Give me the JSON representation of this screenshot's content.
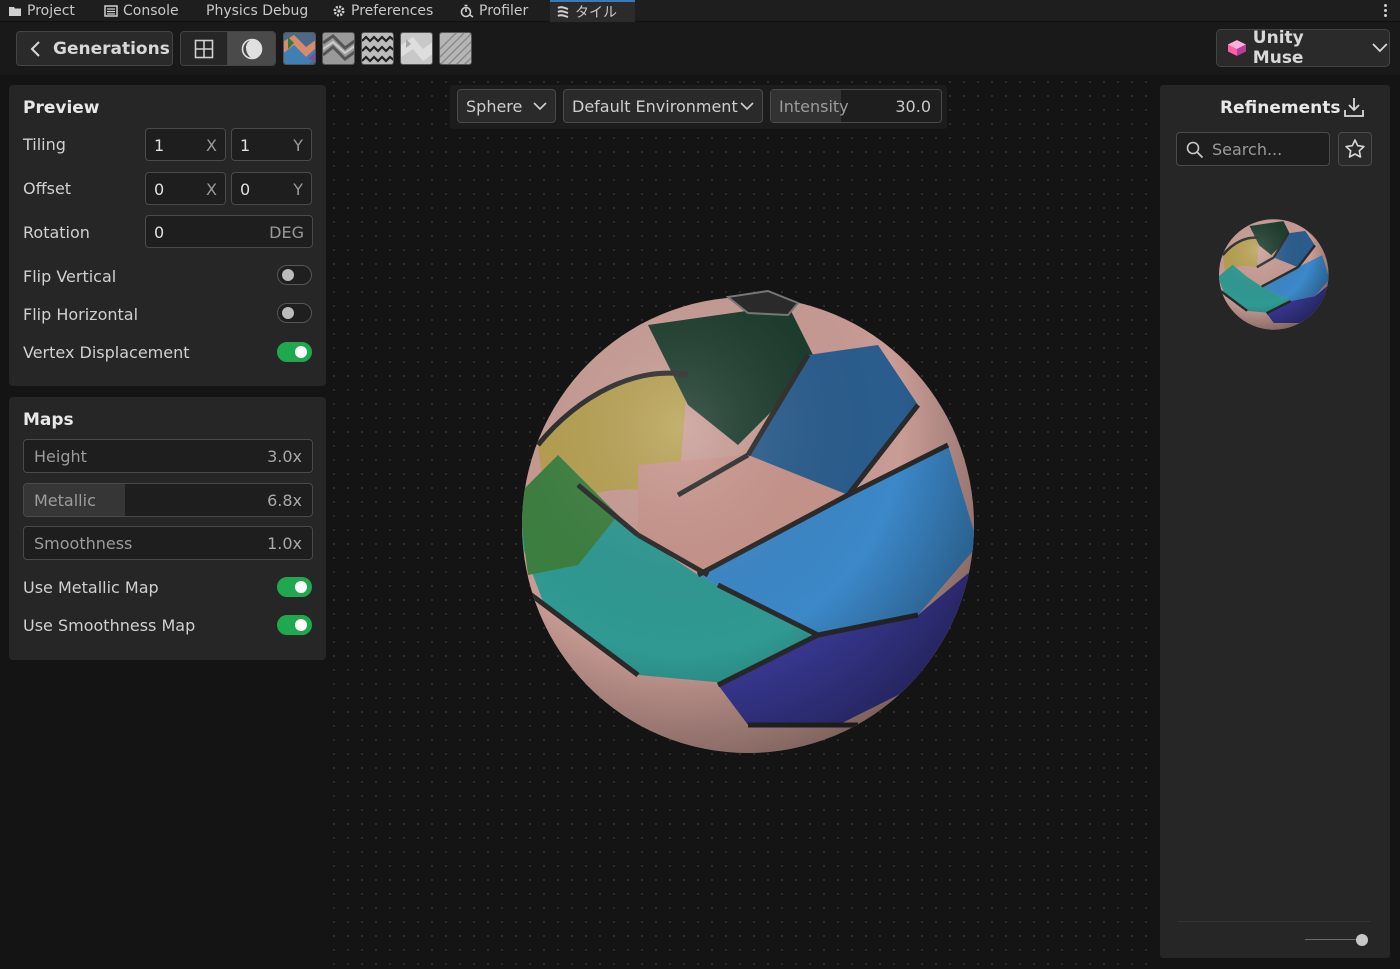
{
  "tabs": [
    {
      "label": "Project",
      "icon": "folder-icon"
    },
    {
      "label": "Console",
      "icon": "console-icon"
    },
    {
      "label": "Physics Debug",
      "icon": ""
    },
    {
      "label": "Preferences",
      "icon": "gear-icon"
    },
    {
      "label": "Profiler",
      "icon": "profiler-icon"
    },
    {
      "label": "タイル",
      "icon": "muse-texture-icon",
      "active": true
    }
  ],
  "toolbar": {
    "back_label": "Generations",
    "view_mode": "sphere",
    "muse_label": "Unity Muse",
    "map_thumbnails": [
      "albedo-map",
      "height-map",
      "normal-map",
      "metallic-map",
      "smoothness-map"
    ]
  },
  "preview": {
    "title": "Preview",
    "tiling_label": "Tiling",
    "tiling_x": "1",
    "tiling_x_unit": "X",
    "tiling_y": "1",
    "tiling_y_unit": "Y",
    "offset_label": "Offset",
    "offset_x": "0",
    "offset_x_unit": "X",
    "offset_y": "0",
    "offset_y_unit": "Y",
    "rotation_label": "Rotation",
    "rotation_value": "0",
    "rotation_unit": "DEG",
    "flip_vertical_label": "Flip Vertical",
    "flip_vertical": false,
    "flip_horizontal_label": "Flip Horizontal",
    "flip_horizontal": false,
    "vertex_displacement_label": "Vertex Displacement",
    "vertex_displacement": true
  },
  "maps": {
    "title": "Maps",
    "height_label": "Height",
    "height_value": "3.0x",
    "height_fill": 0.0,
    "metallic_label": "Metallic",
    "metallic_value": "6.8x",
    "metallic_fill": 0.35,
    "smoothness_label": "Smoothness",
    "smoothness_value": "1.0x",
    "smoothness_fill": 0.0,
    "use_metallic_label": "Use Metallic Map",
    "use_metallic": true,
    "use_smoothness_label": "Use Smoothness Map",
    "use_smoothness": true
  },
  "viewport": {
    "shape": "Sphere",
    "environment": "Default Environment",
    "intensity_label": "Intensity",
    "intensity_value": "30.0"
  },
  "refinements": {
    "title": "Refinements",
    "search_placeholder": "Search...",
    "zoom": 0.9
  },
  "colors": {
    "accent_green": "#1fa84f",
    "active_tab": "#3a79bb"
  }
}
